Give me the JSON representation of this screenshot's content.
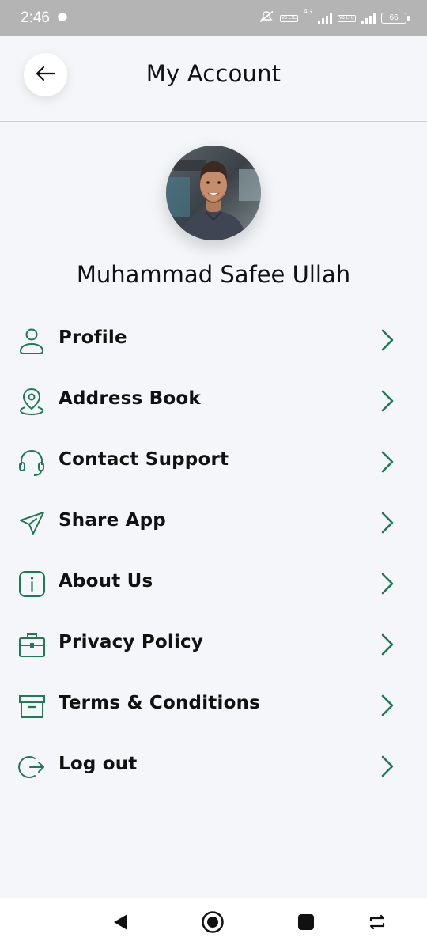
{
  "status_bar": {
    "time": "2:46",
    "network_label": "4G",
    "lte_label": "Vo LTE",
    "battery_level": "66"
  },
  "header": {
    "title": "My Account",
    "back_icon": "arrow-left-icon"
  },
  "profile": {
    "name": "Muhammad Safee Ullah",
    "avatar_icon": "user-photo"
  },
  "menu": {
    "items": [
      {
        "label": "Profile",
        "icon": "user-icon"
      },
      {
        "label": "Address Book",
        "icon": "location-pin-icon"
      },
      {
        "label": "Contact Support",
        "icon": "headset-icon"
      },
      {
        "label": "Share App",
        "icon": "send-icon"
      },
      {
        "label": "About Us",
        "icon": "info-icon"
      },
      {
        "label": "Privacy Policy",
        "icon": "briefcase-icon"
      },
      {
        "label": "Terms & Conditions",
        "icon": "archive-icon"
      },
      {
        "label": "Log out",
        "icon": "logout-icon"
      }
    ]
  },
  "nav_bar": {
    "buttons": [
      "back-triangle-icon",
      "home-circle-icon",
      "recents-square-icon",
      "rotate-icon"
    ]
  },
  "colors": {
    "accent": "#1f7a55",
    "background": "#f4f6fa",
    "status_bar": "#b4b4b4",
    "text": "#111111"
  }
}
